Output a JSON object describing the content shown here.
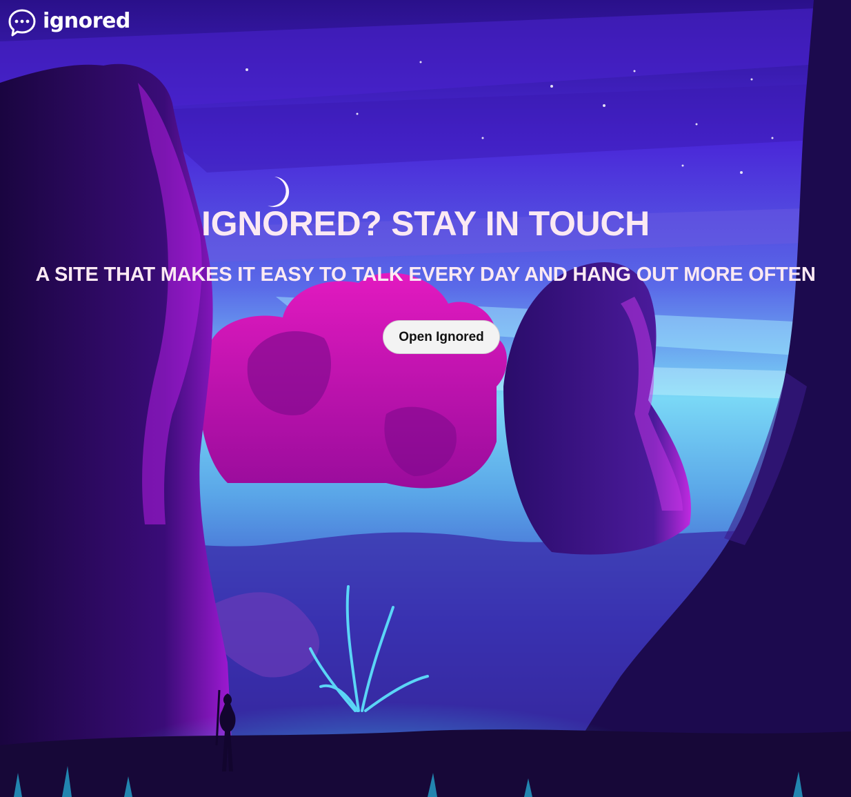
{
  "brand": {
    "name": "ignored",
    "logo_icon": "chat-bubble-dots-icon"
  },
  "hero": {
    "title": "IGNORED? STAY IN TOUCH",
    "subtitle": "A SITE THAT MAKES IT EASY TO TALK EVERY DAY AND HANG OUT MORE OFTEN",
    "cta_label": "Open Ignored"
  },
  "colors": {
    "text": "#fbe9f3",
    "sky_top": "#3a1aa8",
    "sky_glow": "#8af0ff",
    "magenta": "#d21bb8",
    "button_bg": "#f3f3f3"
  }
}
